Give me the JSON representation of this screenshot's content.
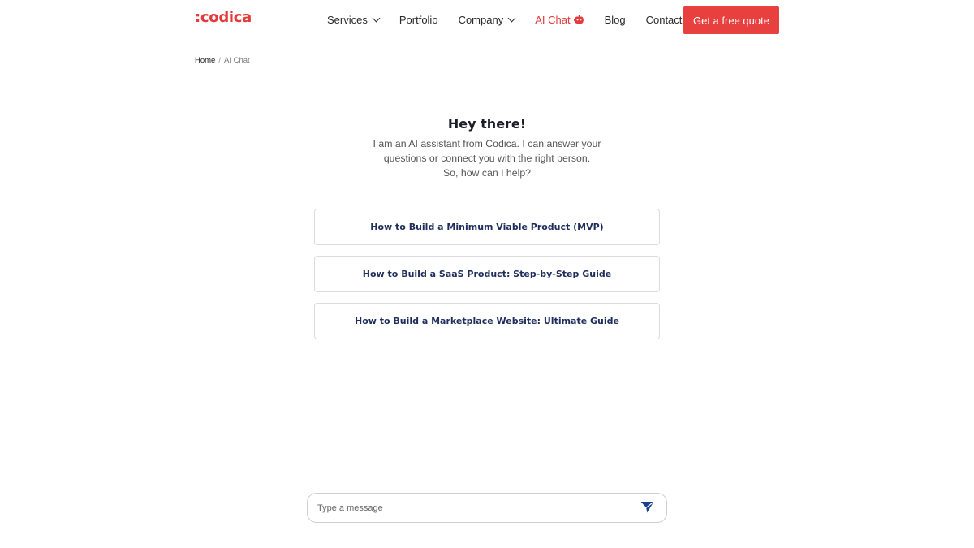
{
  "brand": {
    "logo_text": ":codica",
    "accent_color": "#e83f3f",
    "text_navy": "#1e2d5c"
  },
  "nav": {
    "items": [
      {
        "label": "Services",
        "has_dropdown": true
      },
      {
        "label": "Portfolio",
        "has_dropdown": false
      },
      {
        "label": "Company",
        "has_dropdown": true
      },
      {
        "label": "AI Chat",
        "active": true,
        "icon": "robot-icon"
      },
      {
        "label": "Blog",
        "has_dropdown": false
      },
      {
        "label": "Contact",
        "has_dropdown": false
      }
    ],
    "cta_label": "Get a free quote"
  },
  "breadcrumb": {
    "home": "Home",
    "separator": "/",
    "current": "AI Chat"
  },
  "intro": {
    "title": "Hey there!",
    "line1": "I am an AI assistant from Codica. I can answer your",
    "line2": "questions or connect you with the right person.",
    "line3": "So, how can I help?"
  },
  "suggestions": [
    "How to Build a Minimum Viable Product (MVP)",
    "How to Build a SaaS Product: Step-by-Step Guide",
    "How to Build a Marketplace Website: Ultimate Guide"
  ],
  "composer": {
    "placeholder": "Type a message",
    "send_icon": "send-icon"
  }
}
